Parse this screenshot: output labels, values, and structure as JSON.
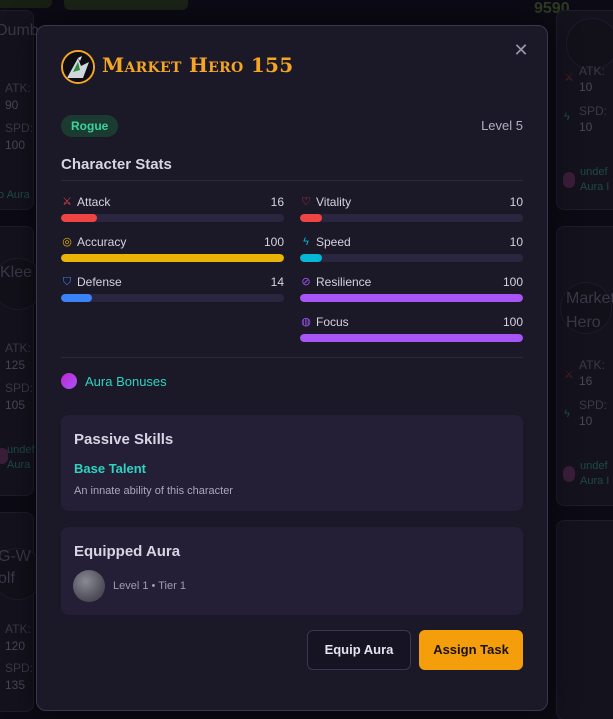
{
  "background": {
    "top_right_score": "9590",
    "left_column": [
      {
        "name": "Dumb",
        "atk_label": "ATK:",
        "atk": "90",
        "spd_label": "SPD:",
        "spd": "100",
        "aura": "o Aura"
      },
      {
        "name": "Klee",
        "atk_label": "ATK:",
        "atk": "125",
        "spd_label": "SPD:",
        "spd": "105",
        "aura_line1": "undef",
        "aura_line2": "Aura"
      },
      {
        "name": "G-Wolf",
        "atk_label": "ATK:",
        "atk": "120",
        "spd_label": "SPD:",
        "spd": "135"
      }
    ],
    "right_column": [
      {
        "atk_label": "ATK:",
        "atk": "10",
        "spd_label": "SPD:",
        "spd": "10",
        "aura_line1": "undef",
        "aura_line2": "Aura I"
      },
      {
        "name_line1": "Market",
        "name_line2": "Hero",
        "atk_label": "ATK:",
        "atk": "16",
        "spd_label": "SPD:",
        "spd": "10",
        "aura_line1": "undef",
        "aura_line2": "Aura I"
      }
    ]
  },
  "modal": {
    "close_icon": "close-icon",
    "hero_name": "Market Hero 155",
    "class_badge": "Rogue",
    "level": "Level 5",
    "stats_title": "Character Stats",
    "stats_left": [
      {
        "label": "Attack",
        "value": "16",
        "max": 100,
        "icon": "swords-icon",
        "glyph": "⚔",
        "color": "#ef4444"
      },
      {
        "label": "Accuracy",
        "value": "100",
        "max": 100,
        "icon": "target-icon",
        "glyph": "◎",
        "color": "#eab308"
      },
      {
        "label": "Defense",
        "value": "14",
        "max": 100,
        "icon": "shield-icon",
        "glyph": "⛉",
        "color": "#3b82f6"
      }
    ],
    "stats_right": [
      {
        "label": "Vitality",
        "value": "10",
        "max": 100,
        "icon": "heart-icon",
        "glyph": "♡",
        "color": "#ef4444"
      },
      {
        "label": "Speed",
        "value": "10",
        "max": 100,
        "icon": "lightning-icon",
        "glyph": "ϟ",
        "color": "#06b6d4"
      },
      {
        "label": "Resilience",
        "value": "100",
        "max": 100,
        "icon": "shield-off-icon",
        "glyph": "⊘",
        "color": "#a855f7"
      },
      {
        "label": "Focus",
        "value": "100",
        "max": 100,
        "icon": "brain-icon",
        "glyph": "◍",
        "color": "#a855f7"
      }
    ],
    "aura_bonuses_label": "Aura Bonuses",
    "passive": {
      "title": "Passive Skills",
      "skill_name": "Base Talent",
      "skill_desc": "An innate ability of this character"
    },
    "equipped": {
      "title": "Equipped Aura",
      "meta": "Level 1 • Tier 1"
    },
    "buttons": {
      "equip": "Equip Aura",
      "assign": "Assign Task"
    },
    "colors": {
      "accent": "#f5a524",
      "teal": "#2dd4bf",
      "primary_button": "#f59e0b"
    }
  }
}
